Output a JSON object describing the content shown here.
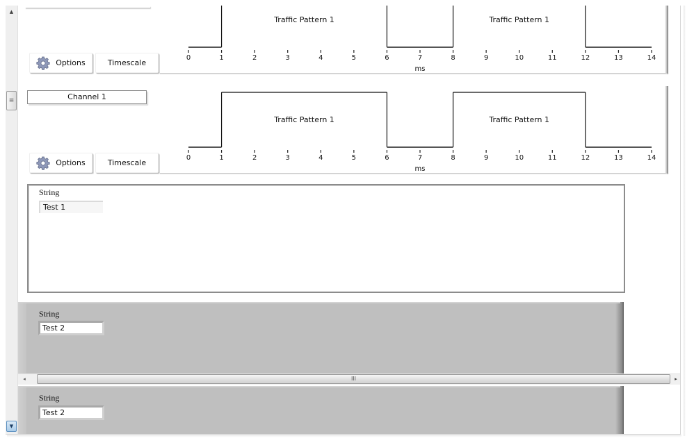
{
  "scrollbars": {
    "vertical": {
      "up_icon": "▲",
      "thumb_icon": "≡",
      "down_icon": "▼"
    },
    "horizontal": {
      "left_icon": "◂",
      "thumb_icon": "III",
      "right_icon": "▸"
    }
  },
  "panels": [
    {
      "channel_label": "",
      "options_label": "Options",
      "timescale_label": "Timescale"
    },
    {
      "channel_label": "Channel 1",
      "options_label": "Options",
      "timescale_label": "Timescale"
    }
  ],
  "chart_data": [
    {
      "type": "line",
      "title": "",
      "xlabel": "ms",
      "ylabel": "",
      "xlim": [
        0,
        14
      ],
      "x_ticks": [
        "0",
        "1",
        "2",
        "3",
        "4",
        "5",
        "6",
        "7",
        "8",
        "9",
        "10",
        "11",
        "12",
        "13",
        "14"
      ],
      "series": [
        {
          "name": "Traffic Pattern 1",
          "step": true,
          "x": [
            0,
            1,
            1,
            6,
            6,
            8,
            8,
            12,
            12,
            14
          ],
          "y": [
            0,
            0,
            1,
            1,
            0,
            0,
            1,
            1,
            0,
            0
          ]
        }
      ],
      "annotations": [
        {
          "text": "Traffic Pattern 1",
          "x": 3.5
        },
        {
          "text": "Traffic Pattern 1",
          "x": 10
        }
      ]
    },
    {
      "type": "line",
      "title": "",
      "xlabel": "ms",
      "ylabel": "",
      "xlim": [
        0,
        14
      ],
      "x_ticks": [
        "0",
        "1",
        "2",
        "3",
        "4",
        "5",
        "6",
        "7",
        "8",
        "9",
        "10",
        "11",
        "12",
        "13",
        "14"
      ],
      "series": [
        {
          "name": "Traffic Pattern 1",
          "step": true,
          "x": [
            0,
            1,
            1,
            6,
            6,
            8,
            8,
            12,
            12,
            14
          ],
          "y": [
            0,
            0,
            1,
            1,
            0,
            0,
            1,
            1,
            0,
            0
          ]
        }
      ],
      "annotations": [
        {
          "text": "Traffic Pattern 1",
          "x": 3.5
        },
        {
          "text": "Traffic Pattern 1",
          "x": 10
        }
      ]
    }
  ],
  "string_controls": [
    {
      "label": "String",
      "value": "Test 1",
      "style": "white"
    },
    {
      "label": "String",
      "value": "Test 2",
      "style": "gray"
    },
    {
      "label": "String",
      "value": "Test 2",
      "style": "gray"
    }
  ]
}
